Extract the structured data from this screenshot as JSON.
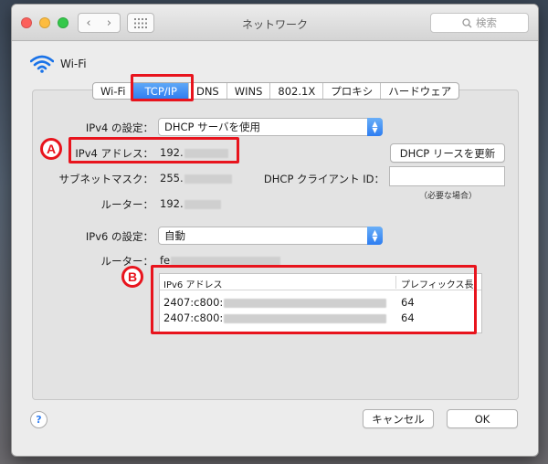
{
  "window": {
    "title": "ネットワーク"
  },
  "search": {
    "placeholder": "検索",
    "icon": "magnifier-icon"
  },
  "nav": {
    "back_glyph": "‹",
    "forward_glyph": "›"
  },
  "interface": {
    "name": "Wi-Fi",
    "icon": "wifi-icon"
  },
  "tabs": [
    {
      "label": "Wi-Fi"
    },
    {
      "label": "TCP/IP",
      "active": true
    },
    {
      "label": "DNS"
    },
    {
      "label": "WINS"
    },
    {
      "label": "802.1X"
    },
    {
      "label": "プロキシ"
    },
    {
      "label": "ハードウェア"
    }
  ],
  "ipv4": {
    "config_label": "IPv4 の設定：",
    "config_value": "DHCP サーバを使用",
    "address_label": "IPv4 アドレス：",
    "address_value": "192.",
    "subnet_label": "サブネットマスク：",
    "subnet_value": "255.",
    "router_label": "ルーター：",
    "router_value": "192."
  },
  "dhcp": {
    "renew_button": "DHCP リースを更新",
    "client_id_label": "DHCP クライアント ID：",
    "client_id_value": "",
    "client_id_note": "（必要な場合）"
  },
  "ipv6": {
    "config_label": "IPv6 の設定：",
    "config_value": "自動",
    "router_label": "ルーター：",
    "router_value": "fe",
    "table": {
      "headers": [
        "IPv6 アドレス",
        "プレフィックス長"
      ],
      "rows": [
        {
          "address": "2407:c800:",
          "prefix": "64"
        },
        {
          "address": "2407:c800:",
          "prefix": "64"
        }
      ]
    }
  },
  "callouts": {
    "a": "A",
    "b": "B"
  },
  "footer": {
    "help": "?",
    "cancel": "キャンセル",
    "ok": "OK"
  },
  "colors": {
    "accent": "#2f7ef2",
    "callout": "#e8141d"
  }
}
